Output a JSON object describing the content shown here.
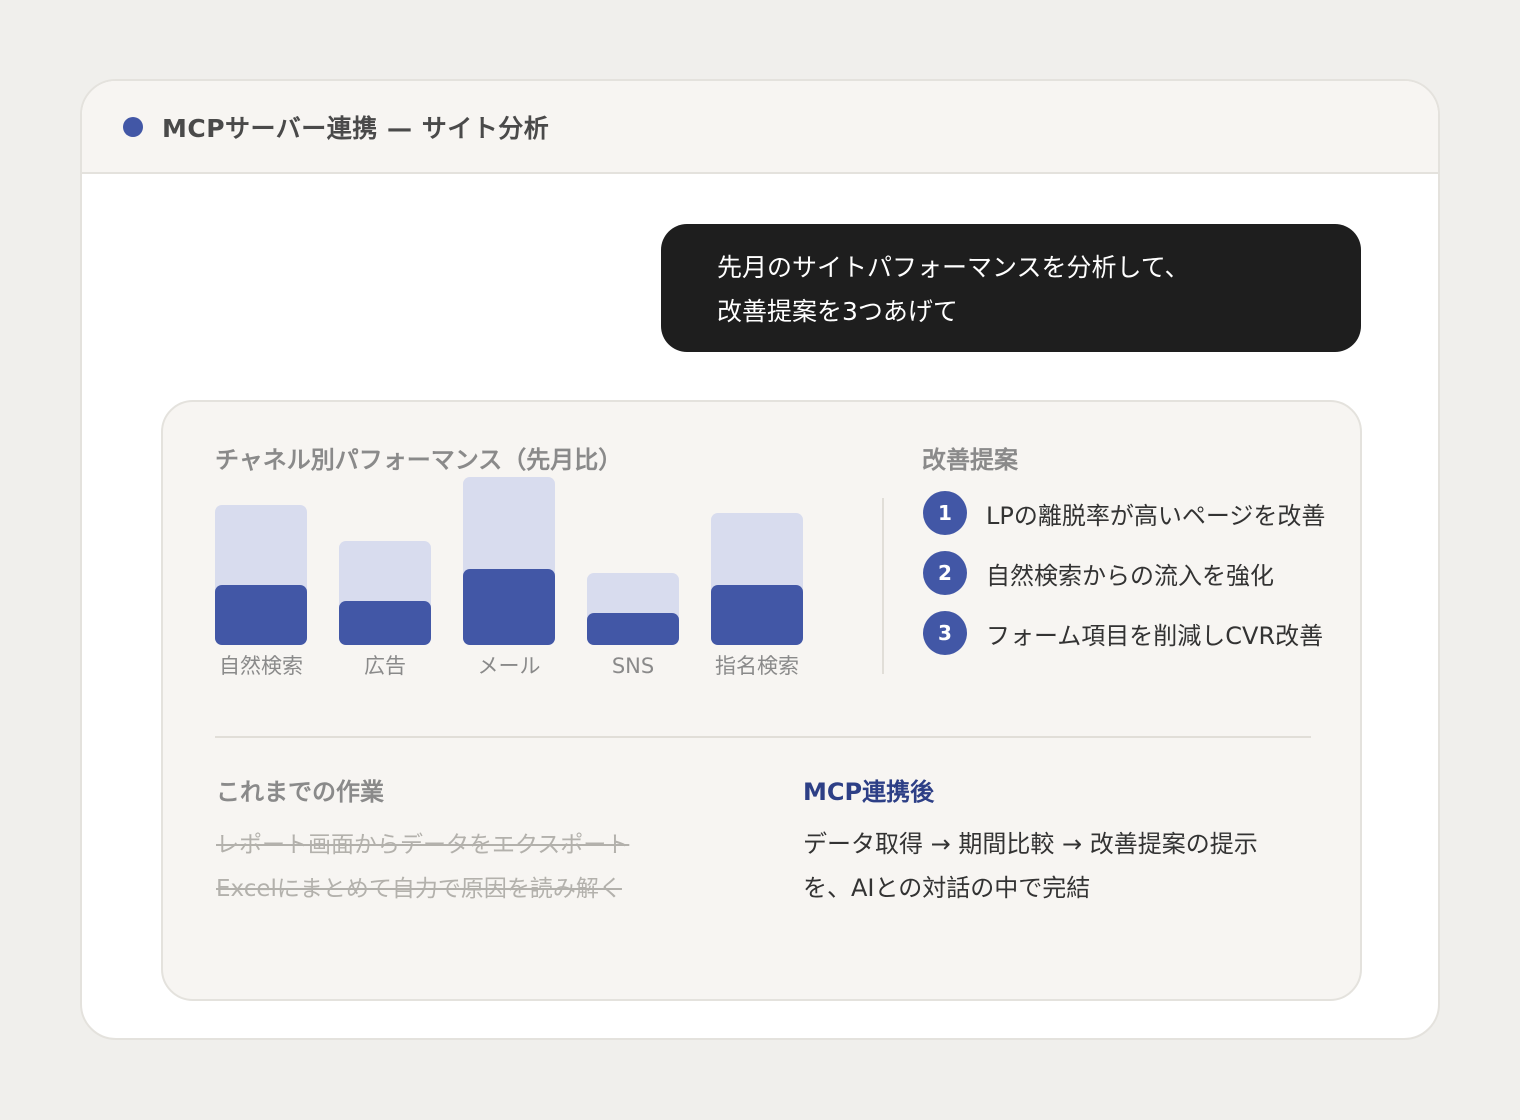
{
  "window": {
    "title": "MCPサーバー連携 — サイト分析"
  },
  "chat": {
    "user_message_line1": "先月のサイトパフォーマンスを分析して、",
    "user_message_line2": "改善提案を3つあげて"
  },
  "chart": {
    "title": "チャネル別パフォーマンス（先月比）"
  },
  "chart_data": {
    "type": "bar",
    "categories": [
      "自然検索",
      "広告",
      "メール",
      "SNS",
      "指名検索"
    ],
    "series": [
      {
        "values": [
          140,
          104,
          168,
          72,
          132
        ],
        "color": "#d8dcee"
      },
      {
        "values": [
          60,
          44,
          76,
          32,
          60
        ],
        "color": "#4257a6"
      }
    ]
  },
  "suggestions": {
    "title": "改善提案",
    "items": [
      {
        "number": "1",
        "text": "LPの離脱率が高いページを改善"
      },
      {
        "number": "2",
        "text": "自然検索からの流入を強化"
      },
      {
        "number": "3",
        "text": "フォーム項目を削減しCVR改善"
      }
    ]
  },
  "comparison": {
    "before_title": "これまでの作業",
    "before_lines": [
      "レポート画面からデータをエクスポート",
      "Excelにまとめて自力で原因を読み解く"
    ],
    "after_title": "MCP連携後",
    "after_lines": [
      "データ取得 → 期間比較 → 改善提案の提示",
      "を、AIとの対話の中で完結"
    ]
  },
  "colors": {
    "accent": "#4257a6",
    "accent_light": "#d8dcee",
    "bubble_bg": "#1e1e1e"
  }
}
